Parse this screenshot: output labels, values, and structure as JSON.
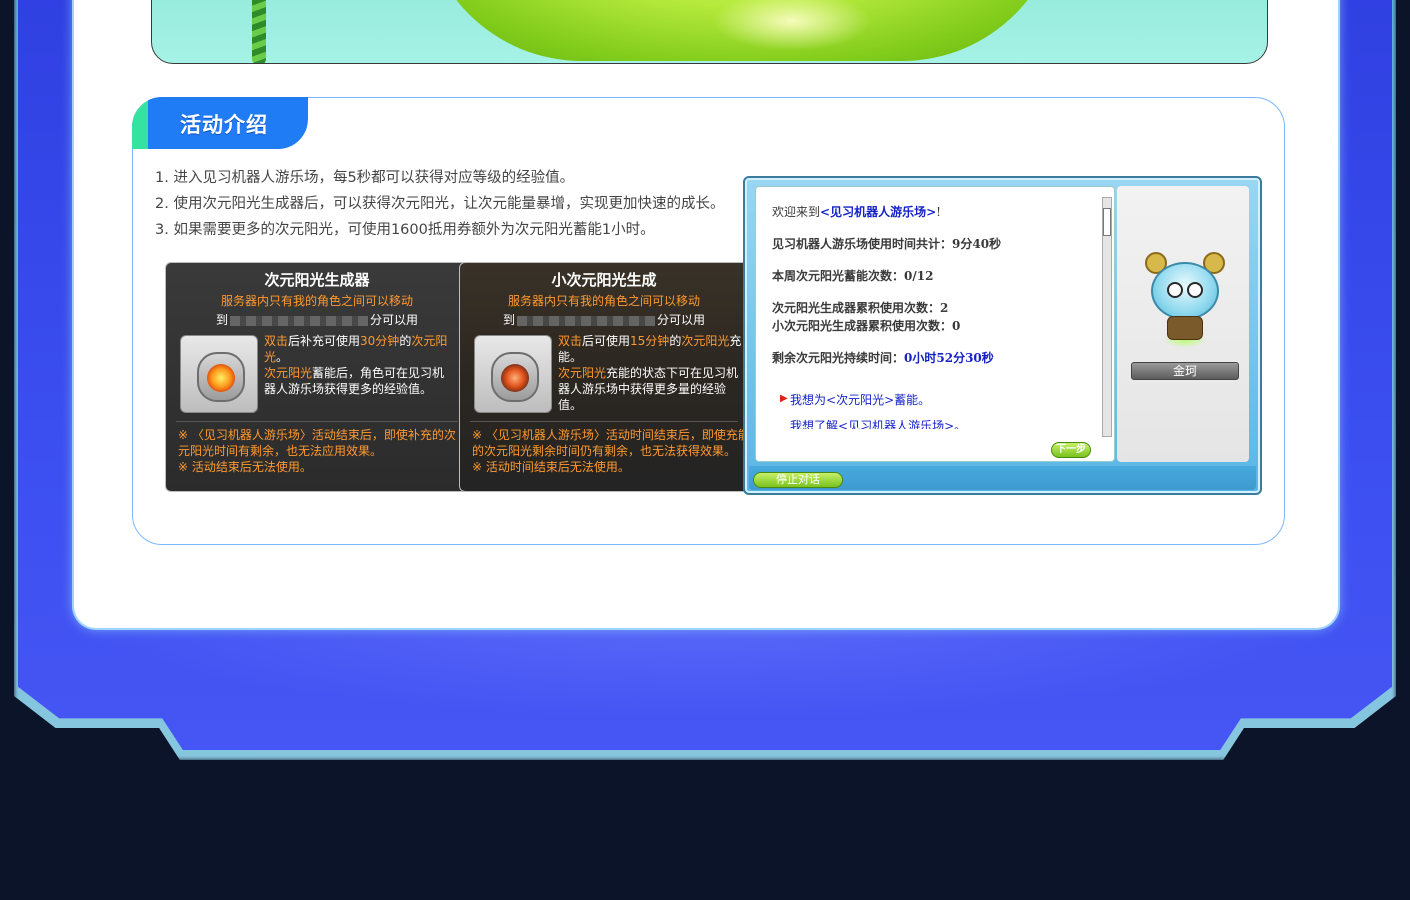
{
  "section": {
    "title": "活动介绍"
  },
  "intro": [
    "1. 进入见习机器人游乐场，每5秒都可以获得对应等级的经验值。",
    "2. 使用次元阳光生成器后，可以获得次元阳光，让次元能量暴增，实现更加快速的成长。",
    "3. 如果需要更多的次元阳光，可使用1600抵用券额外为次元阳光蓄能1小时。"
  ],
  "cards": [
    {
      "title": "次元阳光生成器",
      "sub": "服务器内只有我的角色之间可以移动",
      "to_prefix": "到",
      "to_suffix": "分可以用",
      "desc_hl1": "双击",
      "desc_t1": "后补充可使用",
      "desc_hl2": "30分钟",
      "desc_t2": "的",
      "desc_hl3": "次元阳光",
      "desc_t3": "。",
      "desc_hl4": "次元阳光",
      "desc_t4": "蓄能后，角色可在见习机器人游乐场获得更多的经验值。",
      "note1": "※ 〈见习机器人游乐场〉活动结束后，即使补充的次元阳光时间有剩余，也无法应用效果。",
      "note2": "※ 活动结束后无法使用。"
    },
    {
      "title": "小次元阳光生成",
      "sub": "服务器内只有我的角色之间可以移动",
      "to_prefix": "到",
      "to_suffix": "分可以用",
      "desc_hl1": "双击",
      "desc_t1": "后可使用",
      "desc_hl2": "15分钟",
      "desc_t2": "的",
      "desc_hl3": "次元阳光",
      "desc_t3": "充能。",
      "desc_hl4": "次元阳光",
      "desc_t4": "充能的状态下可在见习机器人游乐场中获得更多量的经验值。",
      "note1": "※ 〈见习机器人游乐场〉活动时间结束后，即使充能的次元阳光剩余时间仍有剩余，也无法获得效果。",
      "note2": "※ 活动时间结束后无法使用。"
    }
  ],
  "npc": {
    "welcome_prefix": "欢迎来到",
    "welcome_place": "<见习机器人游乐场>",
    "welcome_suffix": "!",
    "usage_label": "见习机器人游乐场使用时间共计：",
    "usage_value": "9分40秒",
    "weekly_label": "本周次元阳光蓄能次数：",
    "weekly_value": "0/12",
    "gen_label": "次元阳光生成器累积使用次数：",
    "gen_value": "2",
    "small_gen_label": "小次元阳光生成器累积使用次数：",
    "small_gen_value": "0",
    "remain_label": "剩余次元阳光持续时间：",
    "remain_value": "0小时52分30秒",
    "option1_prefix": "我想为",
    "option1_hl": "<次元阳光>",
    "option1_suffix": "蓄能。",
    "option2_prefix": "我想了解",
    "option2_hl": "<见习机器人游乐场>",
    "option2_suffix": "。",
    "next_label": "下一步",
    "npc_name": "金珂",
    "stop_label": "停止对话"
  },
  "colors": {
    "accent_blue": "#1f7cf5",
    "accent_green": "#35e2a0",
    "frame_blue": "#3b4ef0",
    "highlight_orange": "#ff9a30",
    "npc_link": "#1422c8"
  }
}
